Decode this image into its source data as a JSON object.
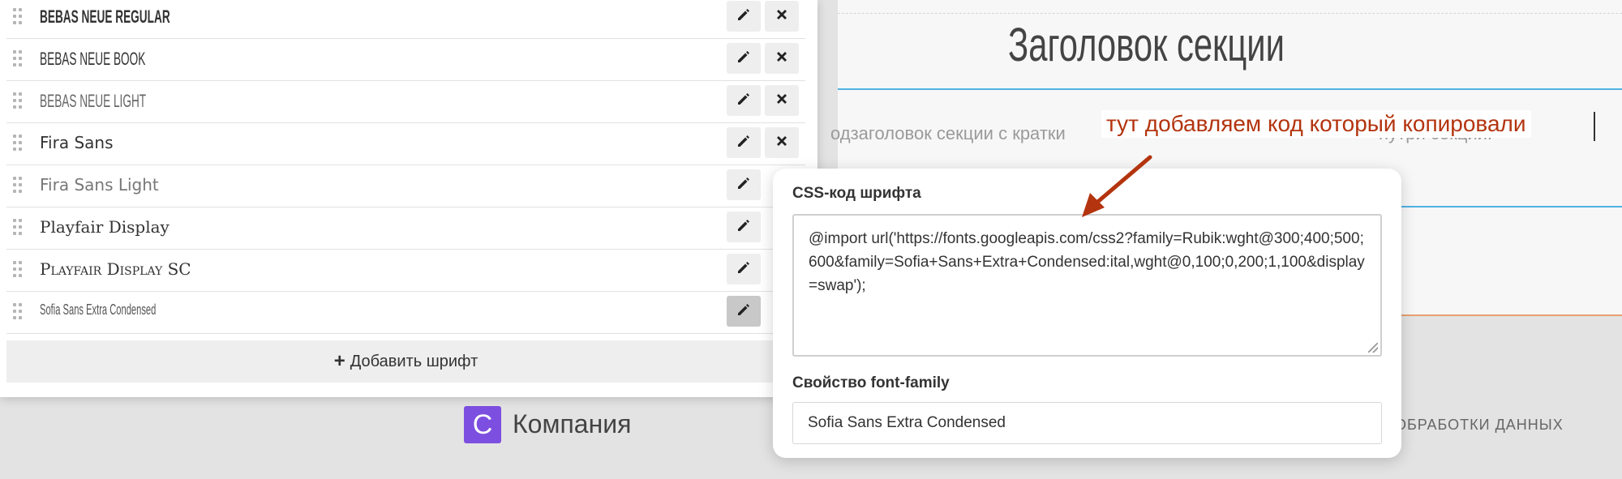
{
  "background": {
    "section_title": "Заголовок секции",
    "subtitle_left": "одзаголовок секции с кратки",
    "subtitle_right": "нутри секции.",
    "footer_logo_letter": "C",
    "footer_company": "Компания",
    "footer_right_text": "И ОБРАБОТКИ ДАННЫХ"
  },
  "annotation": {
    "text": "тут добавляем код который копировали",
    "color": "#b3340e"
  },
  "font_list": {
    "items": [
      {
        "label": "BEBAS NEUE REGULAR"
      },
      {
        "label": "BEBAS NEUE BOOK"
      },
      {
        "label": "BEBAS NEUE LIGHT"
      },
      {
        "label": "Fira Sans"
      },
      {
        "label": "Fira Sans Light"
      },
      {
        "label": "Playfair Display"
      },
      {
        "label": "Playfair Display SC"
      },
      {
        "label": "Sofia Sans Extra Condensed"
      }
    ],
    "add_button_label": "Добавить шрифт"
  },
  "css_popup": {
    "css_label": "CSS-код шрифта",
    "css_value": "@import url('https://fonts.googleapis.com/css2?family=Rubik:wght@300;400;500;600&family=Sofia+Sans+Extra+Condensed:ital,wght@0,100;0,200;1,100&display=swap');",
    "family_label": "Свойство font-family",
    "family_value": "Sofia Sans Extra Condensed"
  },
  "colors": {
    "brand_logo": "#7d4fe0",
    "accent_blue": "#4fb3e3",
    "annotation_red": "#b3340e"
  }
}
